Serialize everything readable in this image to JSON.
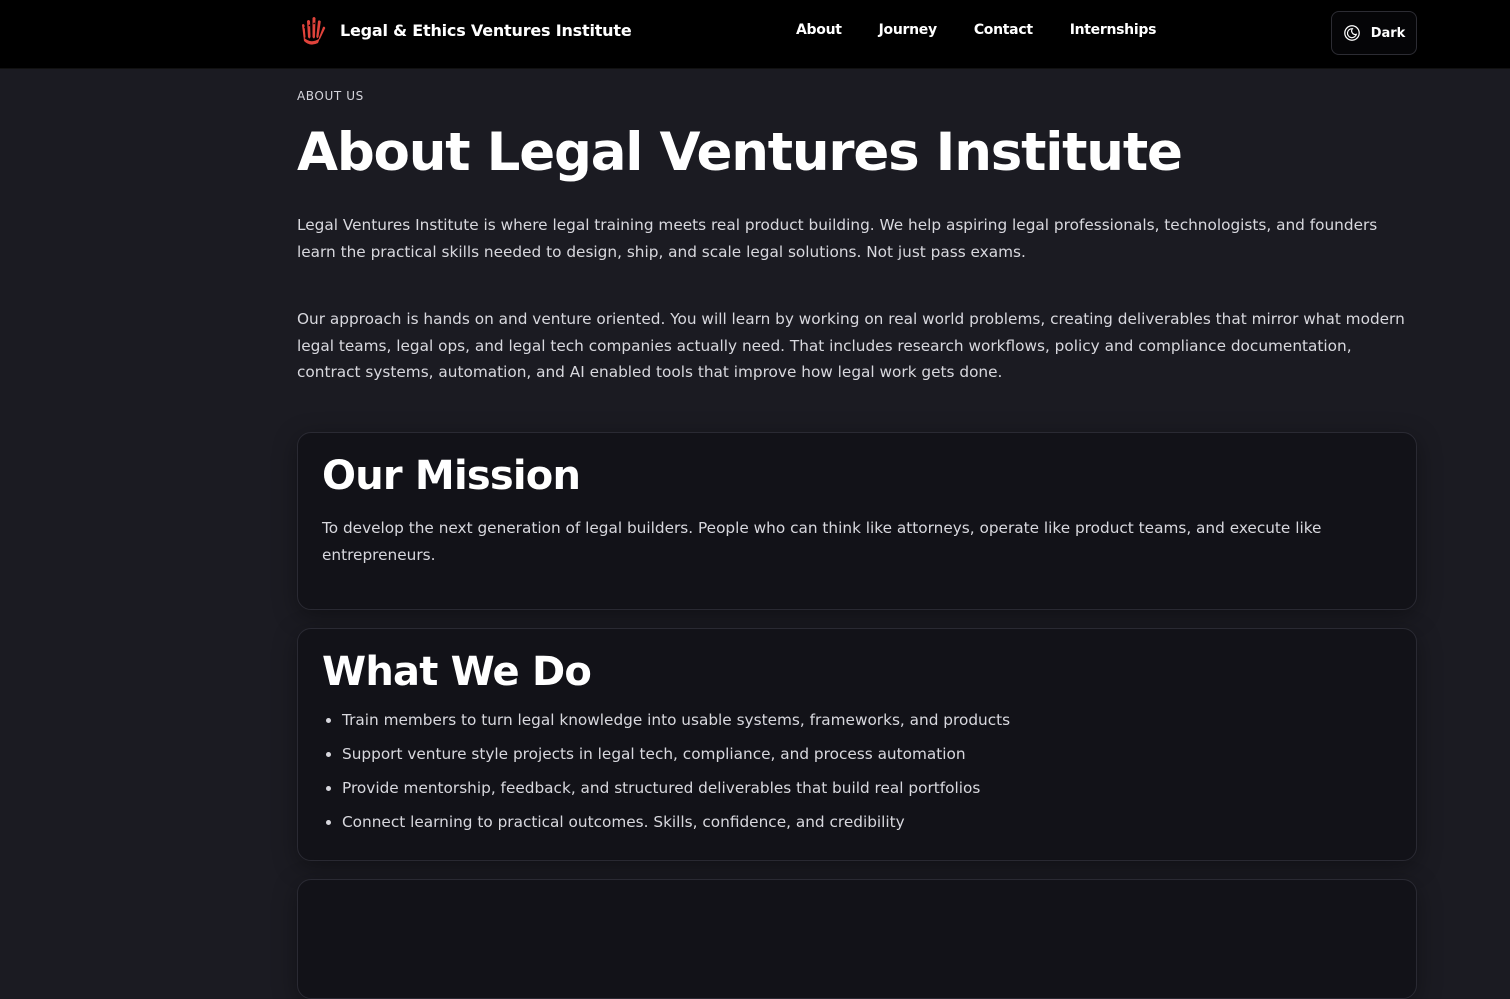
{
  "header": {
    "brand_name": "Legal & Ethics Ventures Institute",
    "logo_icon": "hand-logo-icon",
    "nav": [
      {
        "label": "About"
      },
      {
        "label": "Journey"
      },
      {
        "label": "Contact"
      },
      {
        "label": "Internships"
      }
    ],
    "theme_toggle": {
      "label": "Dark",
      "icon": "moon-icon"
    }
  },
  "page": {
    "eyebrow": "ABOUT US",
    "title": "About Legal Ventures Institute",
    "intro": "Legal Ventures Institute is where legal training meets real product building. We help aspiring legal professionals, technologists, and founders learn the practical skills needed to design, ship, and scale legal solutions. Not just pass exams.",
    "approach": "Our approach is hands on and venture oriented. You will learn by working on real world problems, creating deliverables that mirror what modern legal teams, legal ops, and legal tech companies actually need. That includes research workflows, policy and compliance documentation, contract systems, automation, and AI enabled tools that improve how legal work gets done."
  },
  "mission": {
    "title": "Our Mission",
    "text": "To develop the next generation of legal builders. People who can think like attorneys, operate like product teams, and execute like entrepreneurs."
  },
  "what_we_do": {
    "title": "What We Do",
    "items": [
      "Train members to turn legal knowledge into usable systems, frameworks, and products",
      "Support venture style projects in legal tech, compliance, and process automation",
      "Provide mentorship, feedback, and structured deliverables that build real portfolios",
      "Connect learning to practical outcomes. Skills, confidence, and credibility"
    ]
  },
  "colors": {
    "background": "#1b1b22",
    "header": "#000000",
    "card": "#121218",
    "accent_logo": "#e0433b",
    "text": "#d8d8de"
  }
}
